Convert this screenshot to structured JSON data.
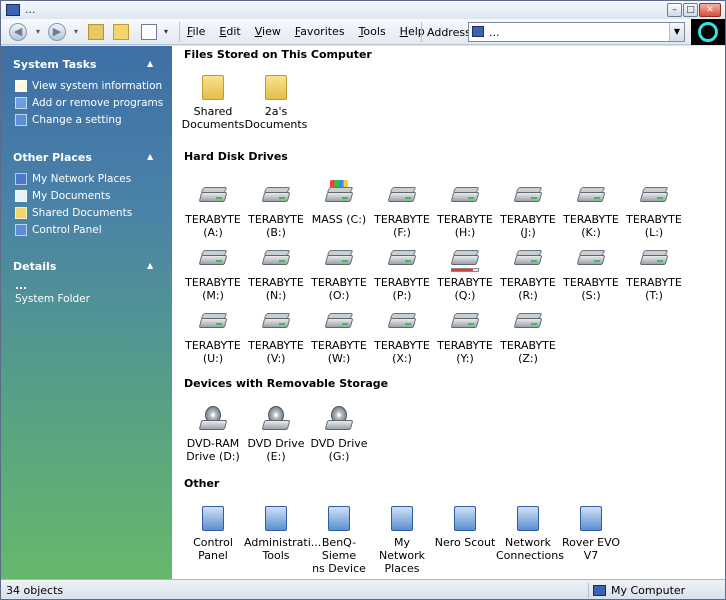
{
  "window": {
    "title": "..."
  },
  "toolbar": {
    "menu": [
      "File",
      "Edit",
      "View",
      "Favorites",
      "Tools",
      "Help"
    ],
    "address_label": "Address",
    "address_value": "..."
  },
  "sidebar": {
    "system_tasks": {
      "title": "System Tasks",
      "items": [
        "View system information",
        "Add or remove programs",
        "Change a setting"
      ]
    },
    "other_places": {
      "title": "Other Places",
      "items": [
        "My Network Places",
        "My Documents",
        "Shared Documents",
        "Control Panel"
      ]
    },
    "details": {
      "title": "Details",
      "name": "...",
      "type": "System Folder"
    }
  },
  "groups": {
    "files": {
      "title": "Files Stored on This Computer",
      "items": [
        {
          "line1": "Shared",
          "line2": "Documents"
        },
        {
          "line1": "2a's",
          "line2": "Documents"
        }
      ]
    },
    "hdd": {
      "title": "Hard Disk Drives",
      "items": [
        {
          "line1": "TERABYTE",
          "line2": "(A:)"
        },
        {
          "line1": "TERABYTE",
          "line2": "(B:)"
        },
        {
          "line1": "MASS (C:)",
          "line2": ""
        },
        {
          "line1": "TERABYTE",
          "line2": "(F:)"
        },
        {
          "line1": "TERABYTE",
          "line2": "(H:)"
        },
        {
          "line1": "TERABYTE",
          "line2": "(J:)"
        },
        {
          "line1": "TERABYTE",
          "line2": "(K:)"
        },
        {
          "line1": "TERABYTE",
          "line2": "(L:)"
        },
        {
          "line1": "TERABYTE",
          "line2": "(M:)"
        },
        {
          "line1": "TERABYTE",
          "line2": "(N:)"
        },
        {
          "line1": "TERABYTE",
          "line2": "(O:)"
        },
        {
          "line1": "TERABYTE",
          "line2": "(P:)"
        },
        {
          "line1": "TERABYTE",
          "line2": "(Q:)"
        },
        {
          "line1": "TERABYTE",
          "line2": "(R:)"
        },
        {
          "line1": "TERABYTE",
          "line2": "(S:)"
        },
        {
          "line1": "TERABYTE",
          "line2": "(T:)"
        },
        {
          "line1": "TERABYTE",
          "line2": "(U:)"
        },
        {
          "line1": "TERABYTE",
          "line2": "(V:)"
        },
        {
          "line1": "TERABYTE",
          "line2": "(W:)"
        },
        {
          "line1": "TERABYTE",
          "line2": "(X:)"
        },
        {
          "line1": "TERABYTE",
          "line2": "(Y:)"
        },
        {
          "line1": "TERABYTE",
          "line2": "(Z:)"
        }
      ]
    },
    "removable": {
      "title": "Devices with Removable Storage",
      "items": [
        {
          "line1": "DVD-RAM",
          "line2": "Drive (D:)"
        },
        {
          "line1": "DVD Drive",
          "line2": "(E:)"
        },
        {
          "line1": "DVD Drive",
          "line2": "(G:)"
        }
      ]
    },
    "other": {
      "title": "Other",
      "items": [
        {
          "line1": "Control",
          "line2": "Panel"
        },
        {
          "line1": "Administrati...",
          "line2": "Tools"
        },
        {
          "line1": "BenQ-Sieme",
          "line2": "ns Device"
        },
        {
          "line1": "My Network",
          "line2": "Places"
        },
        {
          "line1": "Nero Scout",
          "line2": ""
        },
        {
          "line1": "Network",
          "line2": "Connections"
        },
        {
          "line1": "Rover EVO V7",
          "line2": ""
        }
      ]
    }
  },
  "status": {
    "objects": "34 objects",
    "location": "My Computer"
  }
}
